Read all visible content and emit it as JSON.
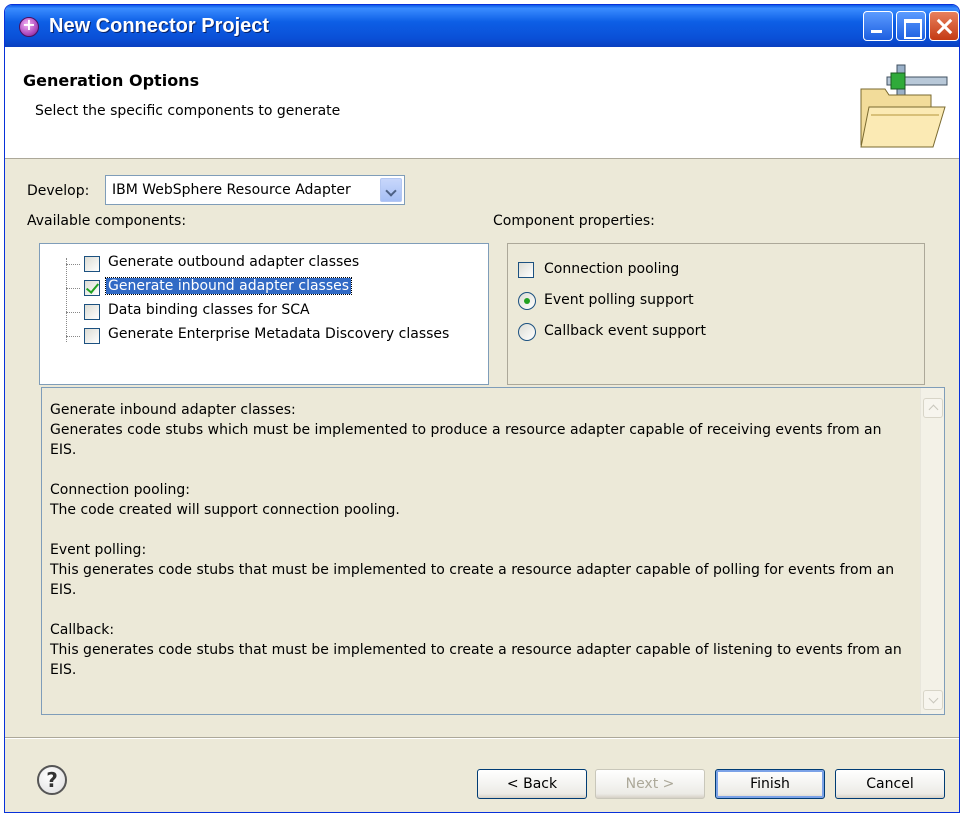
{
  "window": {
    "title": "New Connector Project"
  },
  "header": {
    "title": "Generation Options",
    "description": "Select the specific components to generate"
  },
  "develop": {
    "label": "Develop:",
    "selected": "IBM WebSphere Resource Adapter"
  },
  "components": {
    "label": "Available components:",
    "items": [
      {
        "label": "Generate outbound adapter classes",
        "checked": false,
        "selected": false
      },
      {
        "label": "Generate inbound adapter classes",
        "checked": true,
        "selected": true
      },
      {
        "label": "Data binding classes for SCA",
        "checked": false,
        "selected": false
      },
      {
        "label": "Generate Enterprise Metadata Discovery classes",
        "checked": false,
        "selected": false
      }
    ]
  },
  "properties": {
    "label": "Component properties:",
    "connection_pooling": {
      "label": "Connection pooling",
      "checked": false
    },
    "event_polling": {
      "label": "Event polling support",
      "selected": true
    },
    "callback_event": {
      "label": "Callback event support",
      "selected": false
    }
  },
  "description": {
    "paragraphs": [
      {
        "heading": "Generate inbound adapter classes:",
        "body": "Generates code stubs which must be implemented to produce a resource adapter capable of receiving events from an EIS."
      },
      {
        "heading": "Connection pooling:",
        "body": "The code created will support connection pooling."
      },
      {
        "heading": "Event polling:",
        "body": "This generates code stubs that must be implemented to create a resource adapter capable of polling for events from an EIS."
      },
      {
        "heading": "Callback:",
        "body": "This generates code stubs that must be implemented to create a resource adapter capable of listening to events from an EIS."
      }
    ]
  },
  "buttons": {
    "help": "?",
    "back": "< Back",
    "next": "Next >",
    "finish": "Finish",
    "cancel": "Cancel"
  }
}
